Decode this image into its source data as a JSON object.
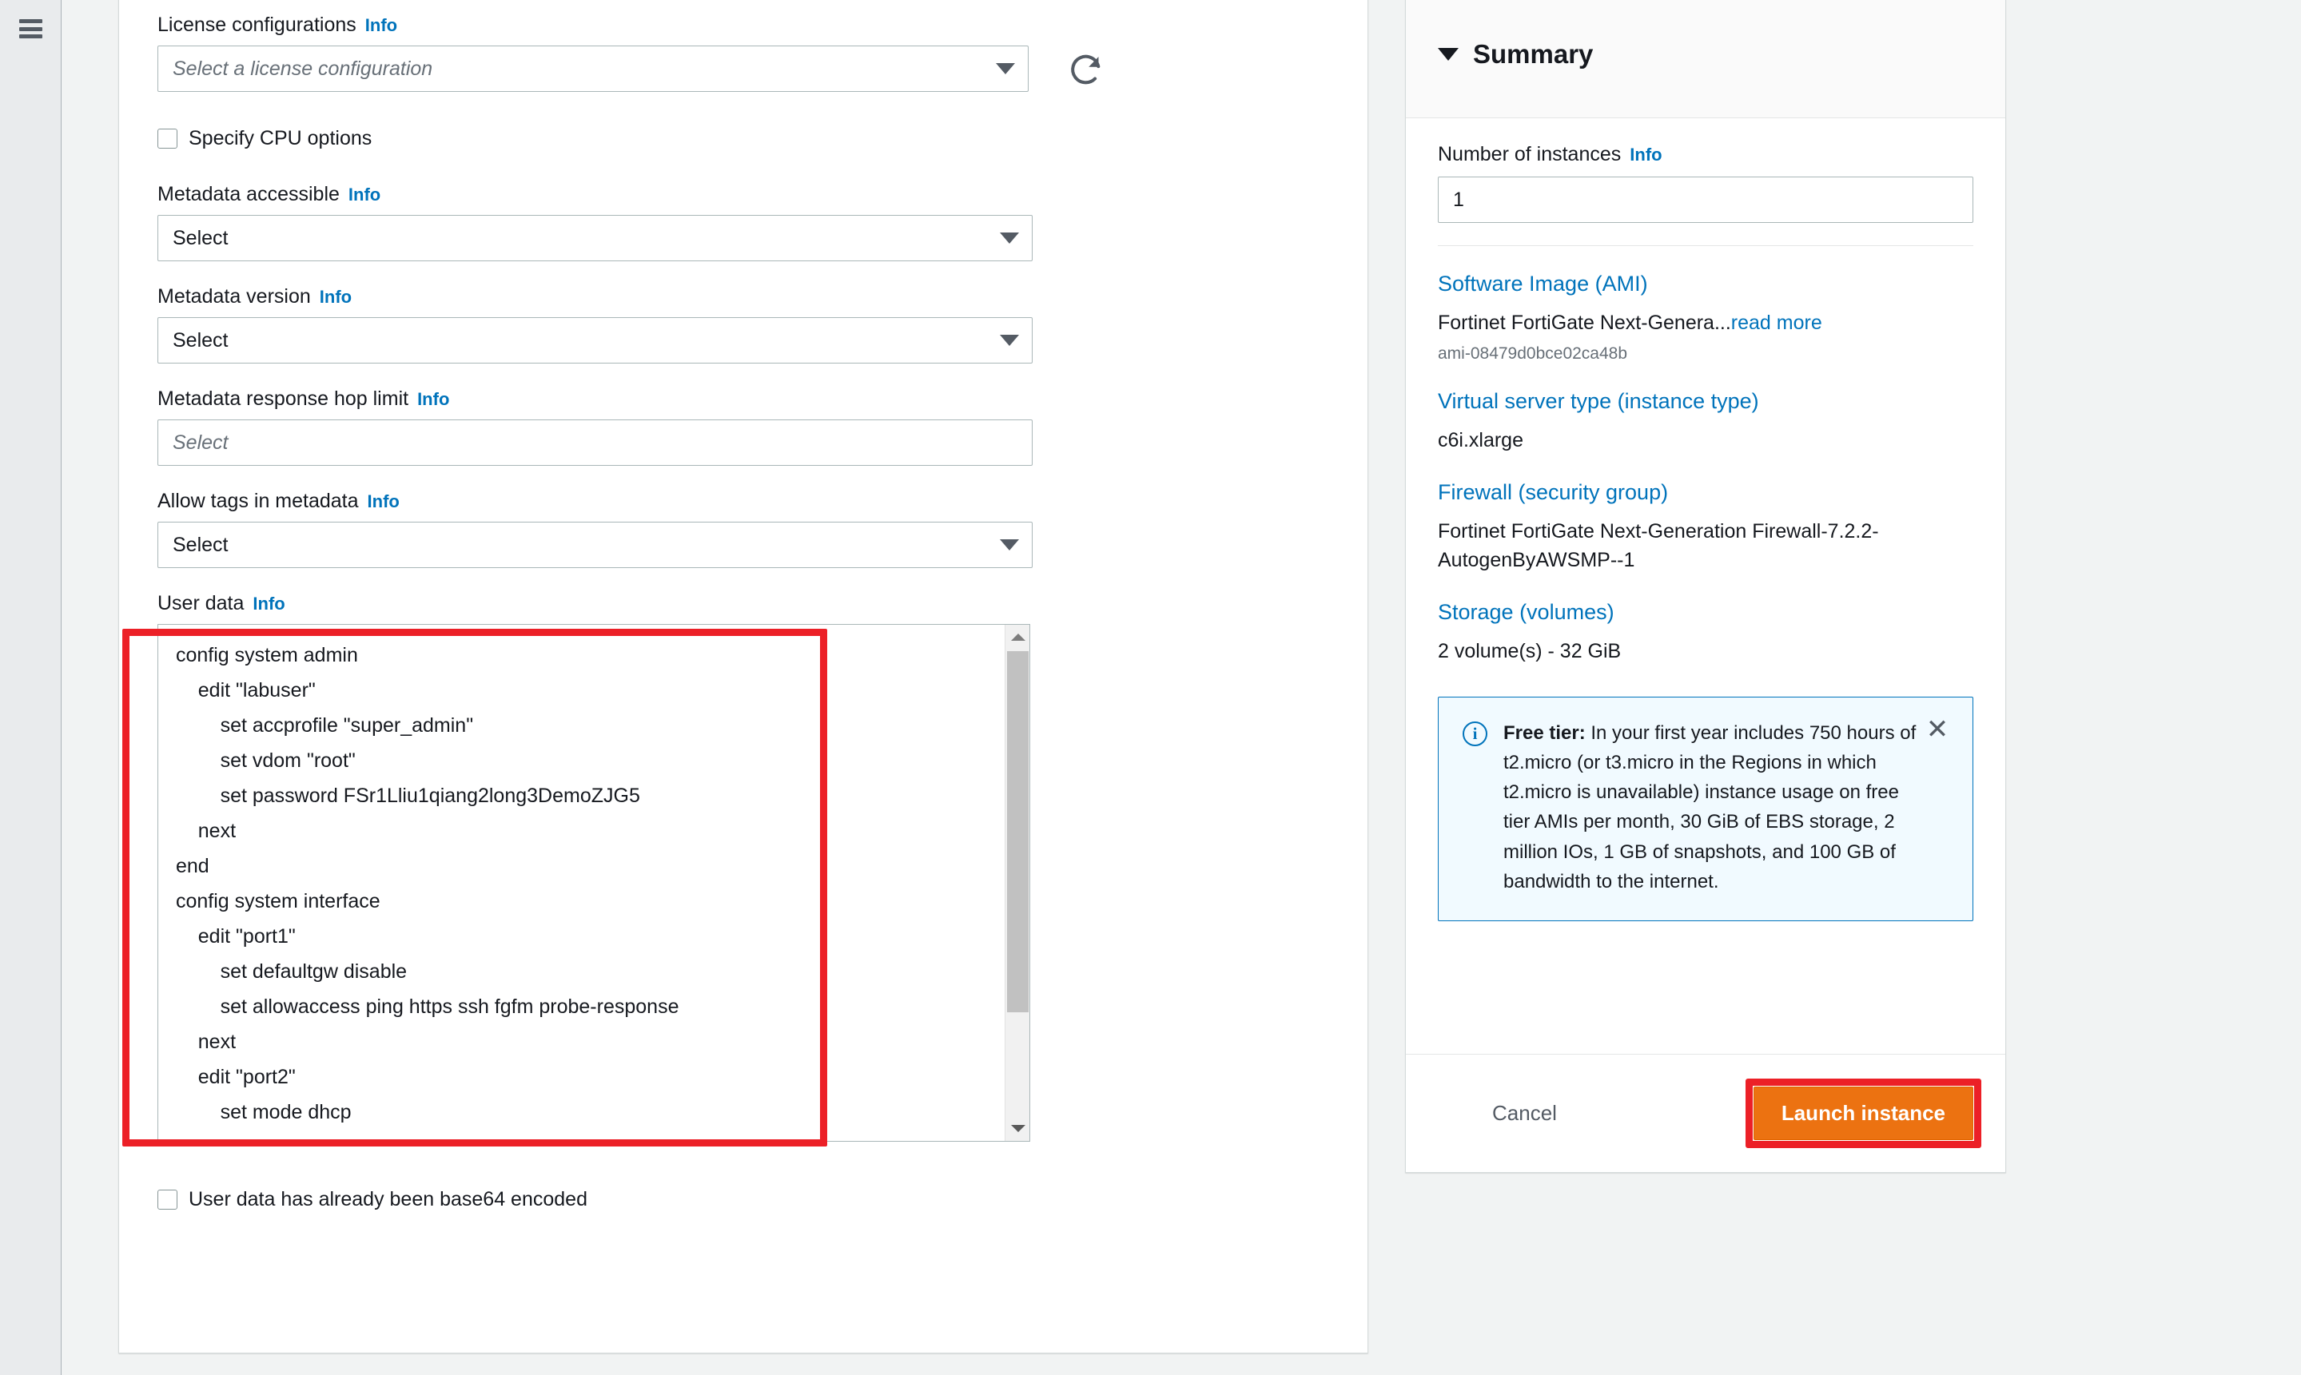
{
  "left_rail": {
    "menu_icon": "hamburger-menu-icon"
  },
  "form": {
    "license_configurations": {
      "label": "License configurations",
      "info": "Info",
      "placeholder": "Select a license configuration",
      "refresh_icon": "refresh-icon"
    },
    "specify_cpu_options": {
      "label": "Specify CPU options",
      "checked": false
    },
    "metadata_accessible": {
      "label": "Metadata accessible",
      "info": "Info",
      "value": "Select"
    },
    "metadata_version": {
      "label": "Metadata version",
      "info": "Info",
      "value": "Select"
    },
    "metadata_hop_limit": {
      "label": "Metadata response hop limit",
      "info": "Info",
      "placeholder": "Select"
    },
    "allow_tags_in_metadata": {
      "label": "Allow tags in metadata",
      "info": "Info",
      "value": "Select"
    },
    "user_data": {
      "label": "User data",
      "info": "Info",
      "value": "config system admin\n    edit \"labuser\"\n        set accprofile \"super_admin\"\n        set vdom \"root\"\n        set password FSr1Lliu1qiang2long3DemoZJG5\n    next\nend\nconfig system interface\n    edit \"port1\"\n        set defaultgw disable\n        set allowaccess ping https ssh fgfm probe-response\n    next\n    edit \"port2\"\n        set mode dhcp\n        set allowaccess ping https ssh fgfm probe-response"
    },
    "base64_checkbox": {
      "label": "User data has already been base64 encoded",
      "checked": false
    }
  },
  "summary": {
    "title": "Summary",
    "collapse_icon": "chevron-down-icon",
    "number_of_instances": {
      "label": "Number of instances",
      "info": "Info",
      "value": "1"
    },
    "items": [
      {
        "link": "Software Image (AMI)",
        "value": "Fortinet FortiGate Next-Genera...",
        "read_more": "read more",
        "sub": "ami-08479d0bce02ca48b"
      },
      {
        "link": "Virtual server type (instance type)",
        "value": "c6i.xlarge"
      },
      {
        "link": "Firewall (security group)",
        "value": "Fortinet FortiGate Next-Generation Firewall-7.2.2-AutogenByAWSMP--1"
      },
      {
        "link": "Storage (volumes)",
        "value": "2 volume(s) - 32 GiB"
      }
    ],
    "alert": {
      "icon": "info-circle-icon",
      "glyph": "i",
      "title": "Free tier:",
      "body": " In your first year includes 750 hours of t2.micro (or t3.micro in the Regions in which t2.micro is unavailable) instance usage on free tier AMIs per month, 30 GiB of EBS storage, 2 million IOs, 1 GB of snapshots, and 100 GB of bandwidth to the internet.",
      "close_icon": "close-icon",
      "close_glyph": "✕"
    },
    "footer": {
      "cancel_label": "Cancel",
      "launch_label": "Launch instance"
    }
  },
  "colors": {
    "link": "#0073bb",
    "launch_button": "#ec7211",
    "highlight": "#ec2027",
    "page_bg": "#f1f3f3",
    "alert_bg": "#f1faff"
  }
}
